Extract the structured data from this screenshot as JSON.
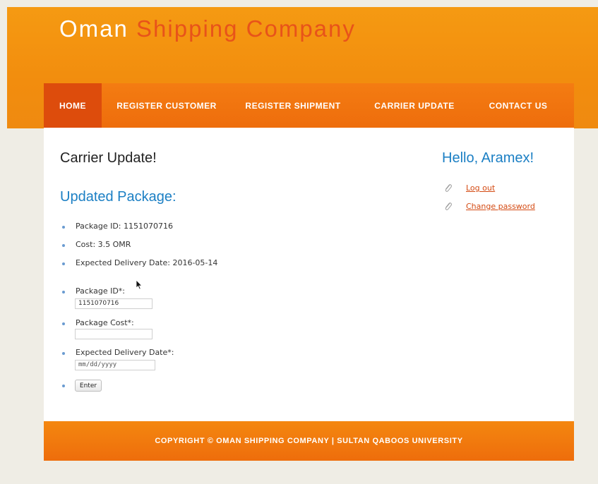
{
  "header": {
    "title_word1": "Oman",
    "title_word2": "Shipping Company"
  },
  "nav": {
    "items": [
      {
        "label": "HOME",
        "active": true
      },
      {
        "label": "REGISTER CUSTOMER",
        "active": false
      },
      {
        "label": "REGISTER SHIPMENT",
        "active": false
      },
      {
        "label": "CARRIER UPDATE",
        "active": false
      },
      {
        "label": "CONTACT US",
        "active": false
      }
    ]
  },
  "main": {
    "heading": "Carrier Update!",
    "subheading": "Updated Package:",
    "info": [
      "Package ID: 1151070716",
      "Cost: 3.5 OMR",
      "Expected Delivery Date: 2016-05-14"
    ],
    "form": {
      "package_id_label": "Package ID*:",
      "package_id_value": "1151070716",
      "package_cost_label": "Package Cost*:",
      "package_cost_value": "",
      "delivery_date_label": "Expected Delivery Date*:",
      "delivery_date_value": "mm/dd/yyyy",
      "submit_label": "Enter"
    }
  },
  "sidebar": {
    "greeting": "Hello, Aramex!",
    "links": [
      {
        "label": "Log out",
        "icon": "paperclip-icon"
      },
      {
        "label": "Change password",
        "icon": "paperclip-icon"
      }
    ]
  },
  "footer": {
    "text": "COPYRIGHT © OMAN SHIPPING COMPANY | SULTAN QABOOS UNIVERSITY"
  },
  "colors": {
    "header_orange": "#f59a12",
    "nav_orange": "#ee6d0c",
    "active_tab": "#dd4c0c",
    "accent_blue": "#1b7fc4",
    "link_red": "#d44a12"
  }
}
